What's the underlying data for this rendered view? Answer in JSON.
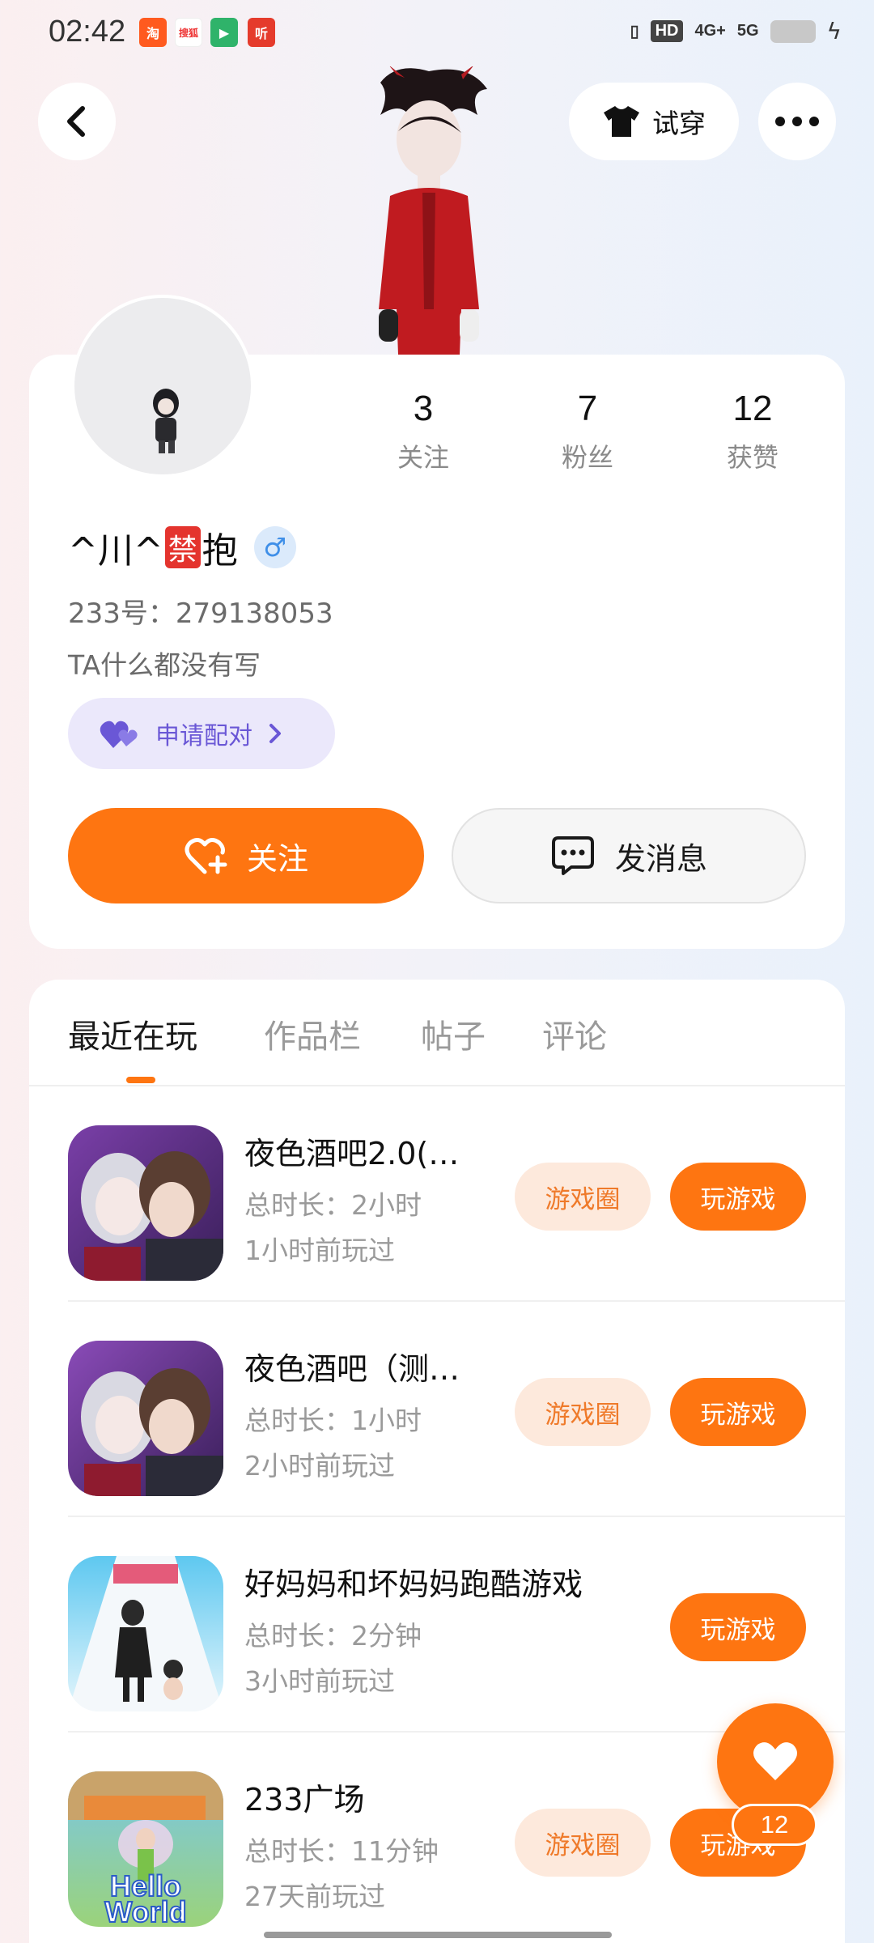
{
  "status_bar": {
    "time": "02:42",
    "notif_icons": [
      "淘",
      "搜狐",
      "▶",
      "听"
    ],
    "hd_label": "HD",
    "net_4g": "4G+",
    "net_5g": "5G"
  },
  "header": {
    "try_on_label": "试穿"
  },
  "profile": {
    "stats": [
      {
        "value": "3",
        "label": "关注"
      },
      {
        "value": "7",
        "label": "粉丝"
      },
      {
        "value": "12",
        "label": "获赞"
      }
    ],
    "nickname_prefix": "^川^",
    "nickname_emoji": "禁",
    "nickname_suffix": "抱",
    "gender_symbol": "♂",
    "uid": "233号：279138053",
    "bio": "TA什么都没有写",
    "pair_label": "申请配对",
    "follow_label": "关注",
    "message_label": "发消息"
  },
  "tabs": [
    "最近在玩",
    "作品栏",
    "帖子",
    "评论"
  ],
  "games": [
    {
      "name": "夜色酒吧2.0(…",
      "duration": "总时长：2小时",
      "last_played": "1小时前玩过",
      "circle_label": "游戏圈",
      "play_label": "玩游戏"
    },
    {
      "name": "夜色酒吧（测…",
      "duration": "总时长：1小时",
      "last_played": "2小时前玩过",
      "circle_label": "游戏圈",
      "play_label": "玩游戏"
    },
    {
      "name": "好妈妈和坏妈妈跑酷游戏",
      "duration": "总时长：2分钟",
      "last_played": "3小时前玩过",
      "play_label": "玩游戏"
    },
    {
      "name": "233广场",
      "duration": "总时长：11分钟",
      "last_played": "27天前玩过",
      "circle_label": "游戏圈",
      "play_label": "玩游戏",
      "icon_text_1": "Hello",
      "icon_text_2": "World"
    }
  ],
  "fab": {
    "count": "12"
  },
  "colors": {
    "accent": "#fe7511",
    "pair": "#6a57d6"
  }
}
